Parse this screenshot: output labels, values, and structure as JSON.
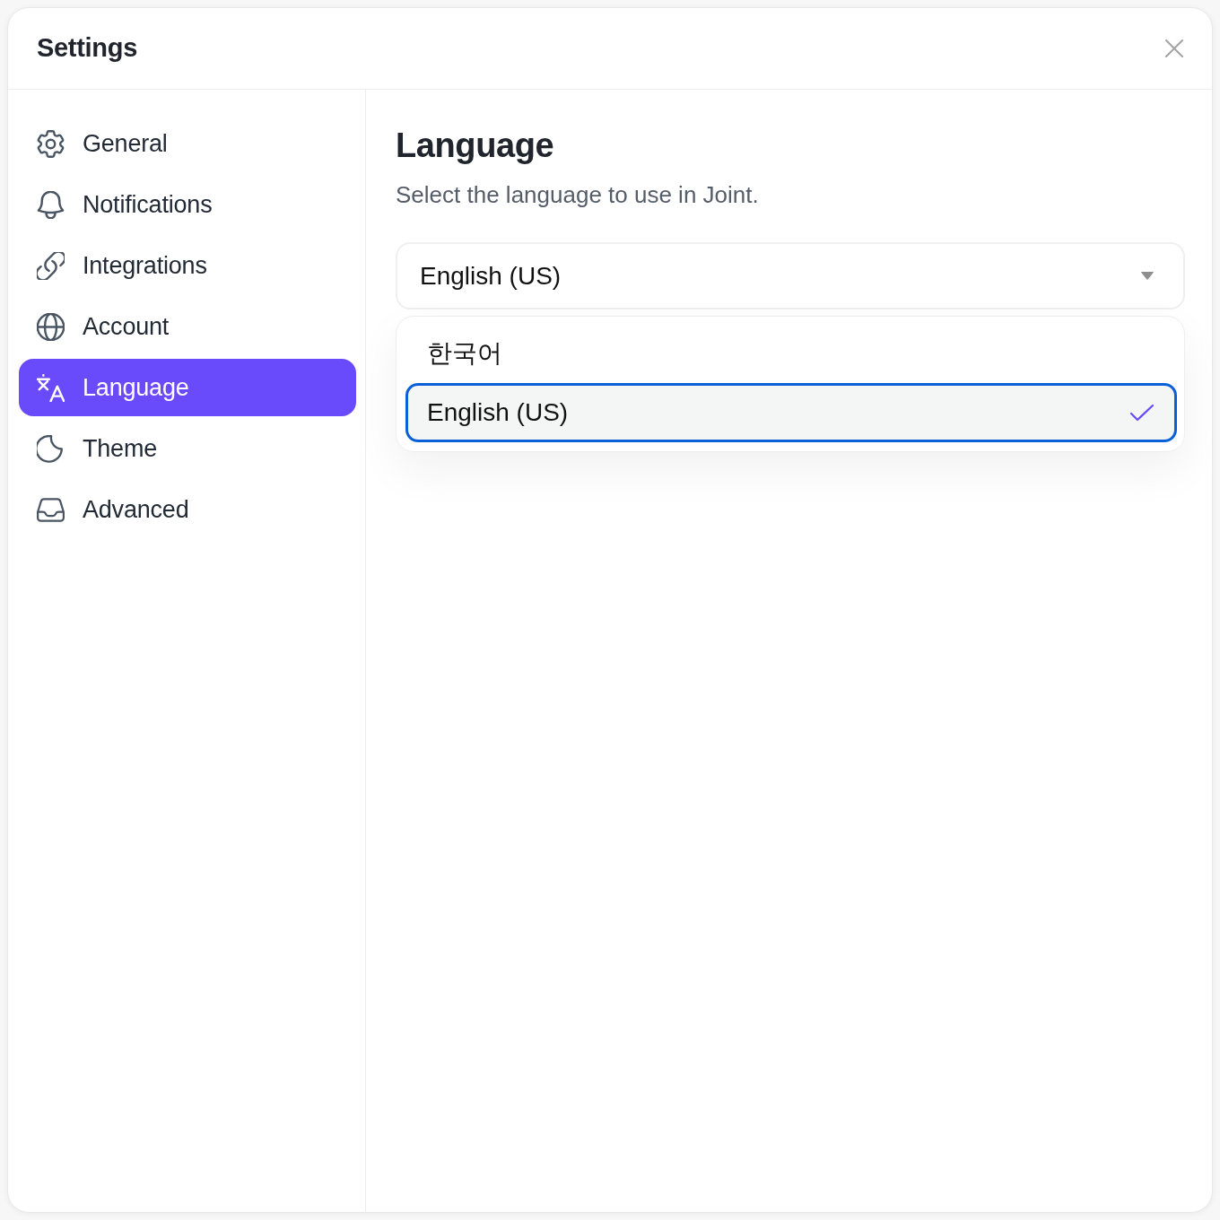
{
  "window": {
    "title": "Settings"
  },
  "sidebar": {
    "items": [
      {
        "label": "General",
        "selected": false
      },
      {
        "label": "Notifications",
        "selected": false
      },
      {
        "label": "Integrations",
        "selected": false
      },
      {
        "label": "Account",
        "selected": false
      },
      {
        "label": "Language",
        "selected": true
      },
      {
        "label": "Theme",
        "selected": false
      },
      {
        "label": "Advanced",
        "selected": false
      }
    ]
  },
  "content": {
    "heading": "Language",
    "description": "Select the language to use in Joint.",
    "language_select": {
      "value": "English (US)",
      "expanded": true,
      "options": [
        {
          "label": "한국어",
          "selected": false
        },
        {
          "label": "English (US)",
          "selected": true
        }
      ]
    }
  }
}
